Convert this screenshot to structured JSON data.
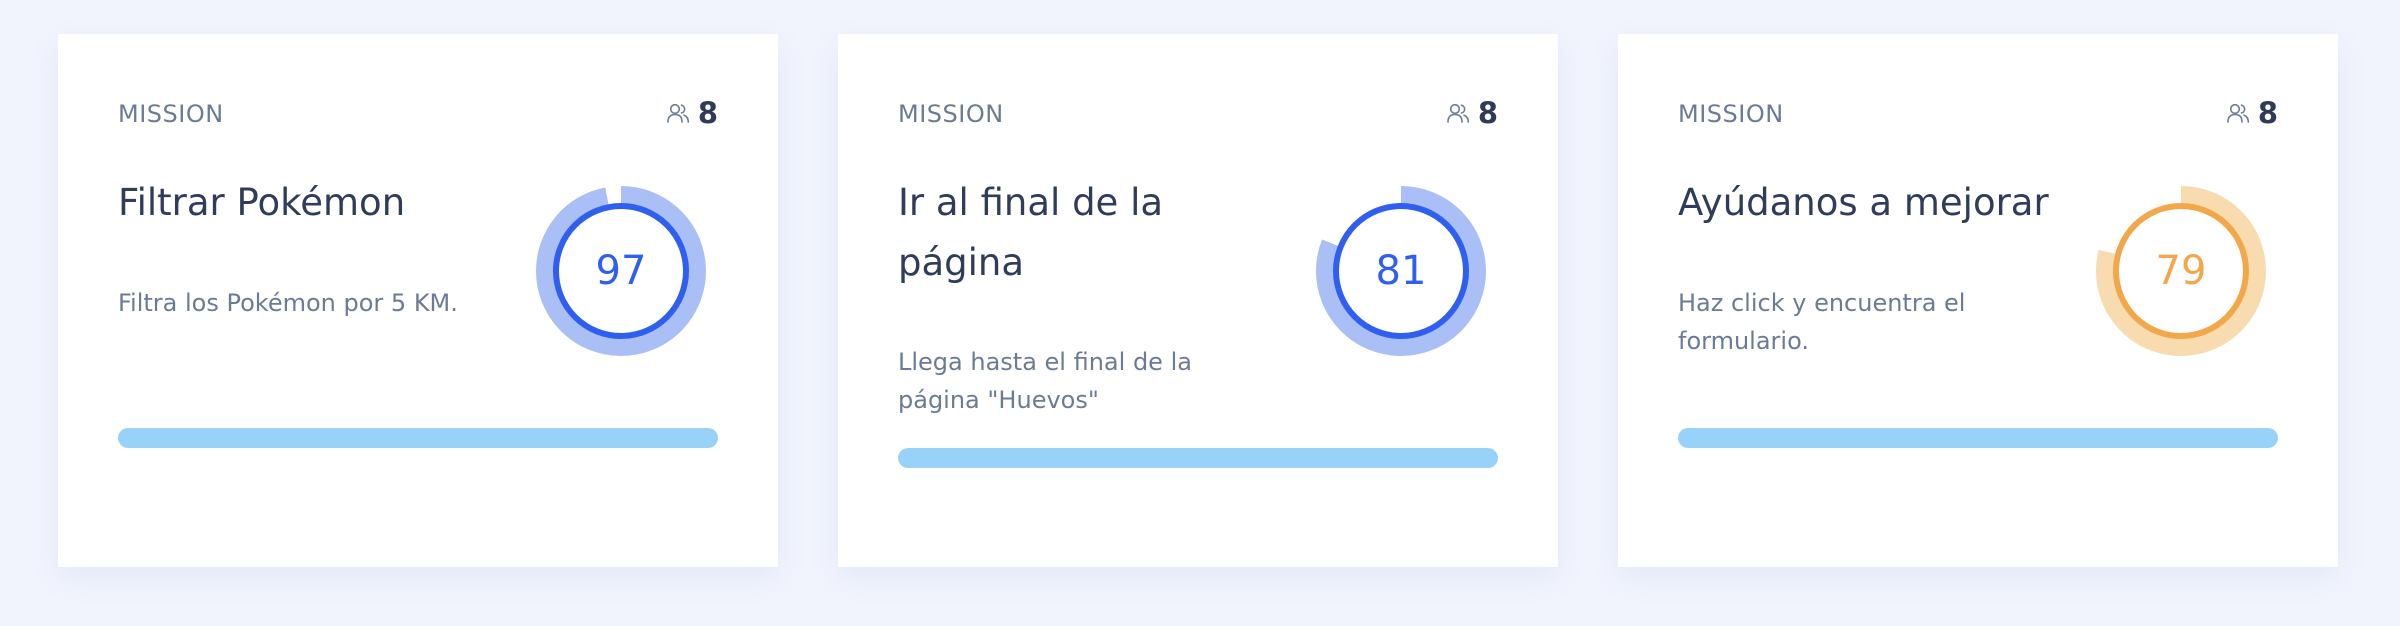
{
  "colors": {
    "background": "#f1f4fd",
    "card": "#ffffff",
    "text_primary": "#2f3d5b",
    "text_secondary": "#6c7b95",
    "progress_bar": "#99d2f9"
  },
  "missions": [
    {
      "label": "MISSION",
      "members_icon": "users-icon",
      "members_count": "8",
      "title": "Filtrar Pokémon",
      "description": "Filtra los Pokémon por 5 KM.",
      "score": "97",
      "score_fraction": 0.97,
      "ring_color": "#2f5ff0",
      "ring_track_color": "#aabff5",
      "progress_fraction": 1.0
    },
    {
      "label": "MISSION",
      "members_icon": "users-icon",
      "members_count": "8",
      "title": "Ir al final de la página",
      "description": "Llega hasta el final de la página \"Huevos\"",
      "score": "81",
      "score_fraction": 0.81,
      "ring_color": "#2f5ff0",
      "ring_track_color": "#aabff5",
      "progress_fraction": 1.0
    },
    {
      "label": "MISSION",
      "members_icon": "users-icon",
      "members_count": "8",
      "title": "Ayúdanos a mejorar",
      "description": "Haz click y encuentra el formulario.",
      "score": "79",
      "score_fraction": 0.79,
      "ring_color": "#f2a84a",
      "ring_track_color": "#f8dcb0",
      "progress_fraction": 1.0
    }
  ]
}
